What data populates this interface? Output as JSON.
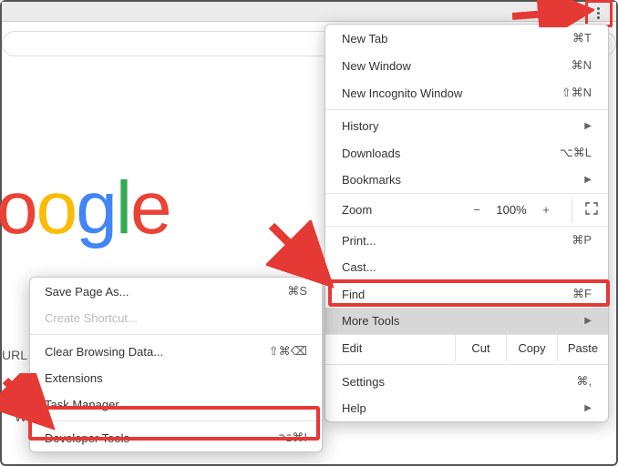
{
  "browser": {
    "url_label": "URL",
    "misc_w": "W",
    "logo_letters": [
      "o",
      "o",
      "g",
      "l",
      "e"
    ]
  },
  "menu": {
    "newTab": {
      "label": "New Tab",
      "shortcut": "⌘T"
    },
    "newWindow": {
      "label": "New Window",
      "shortcut": "⌘N"
    },
    "newIncognito": {
      "label": "New Incognito Window",
      "shortcut": "⇧⌘N"
    },
    "history": {
      "label": "History"
    },
    "downloads": {
      "label": "Downloads",
      "shortcut": "⌥⌘L"
    },
    "bookmarks": {
      "label": "Bookmarks"
    },
    "zoom": {
      "label": "Zoom",
      "minus": "−",
      "pct": "100%",
      "plus": "+",
      "fullscreen": "⤢"
    },
    "print": {
      "label": "Print...",
      "shortcut": "⌘P"
    },
    "cast": {
      "label": "Cast..."
    },
    "find": {
      "label": "Find",
      "shortcut": "⌘F"
    },
    "moreTools": {
      "label": "More Tools"
    },
    "edit": {
      "label": "Edit",
      "cut": "Cut",
      "copy": "Copy",
      "paste": "Paste"
    },
    "settings": {
      "label": "Settings",
      "shortcut": "⌘,"
    },
    "help": {
      "label": "Help"
    }
  },
  "submenu": {
    "savePage": {
      "label": "Save Page As...",
      "shortcut": "⌘S"
    },
    "createShortcut": {
      "label": "Create Shortcut..."
    },
    "clearData": {
      "label": "Clear Browsing Data...",
      "shortcut": "⇧⌘⌫"
    },
    "extensions": {
      "label": "Extensions"
    },
    "taskManager": {
      "label": "Task Manager"
    },
    "devTools": {
      "label": "Developer Tools",
      "shortcut": "⌥⌘I"
    }
  },
  "annotations": {
    "kebab_highlight": true,
    "moretools_highlight": true,
    "devtools_highlight": true
  }
}
